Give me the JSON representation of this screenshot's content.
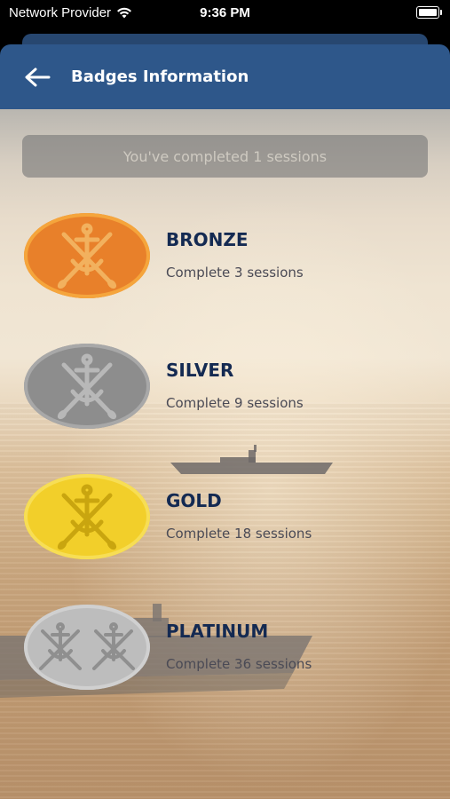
{
  "status_bar": {
    "carrier": "Network Provider",
    "time": "9:36 PM",
    "icons": [
      "wifi-icon",
      "battery-icon"
    ]
  },
  "header": {
    "back_icon": "arrow-left-icon",
    "title": "Badges Information"
  },
  "progress": {
    "text": "You've completed 1 sessions"
  },
  "badges": [
    {
      "name": "BRONZE",
      "description": "Complete 3 sessions",
      "color": "#e8802a",
      "border": "#f5a53c",
      "emblem": "anchor-crossed-oars-icon"
    },
    {
      "name": "SILVER",
      "description": "Complete 9 sessions",
      "color": "#8d8d8d",
      "border": "#a8a8a8",
      "emblem": "anchor-crossed-oars-icon"
    },
    {
      "name": "GOLD",
      "description": "Complete 18 sessions",
      "color": "#f2cf2a",
      "border": "#f7de55",
      "emblem": "anchor-crossed-oars-icon"
    },
    {
      "name": "PLATINUM",
      "description": "Complete 36 sessions",
      "color": "#bdbdbd",
      "border": "#d0d0d0",
      "emblem": "double-anchor-crossed-oars-icon"
    }
  ],
  "colors": {
    "header_bg": "#2e578a",
    "badge_title": "#142a52"
  }
}
